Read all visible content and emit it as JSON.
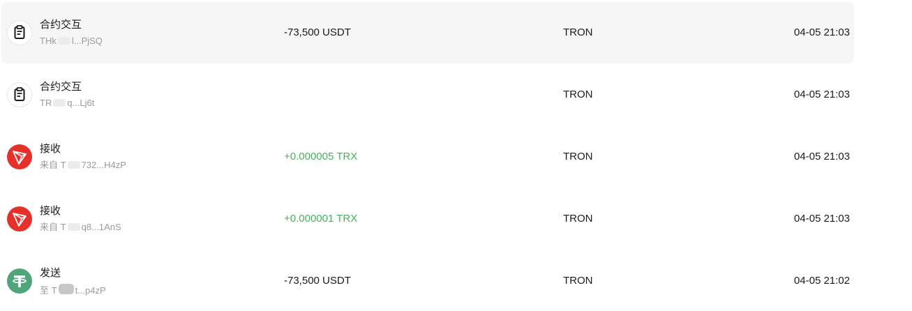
{
  "colors": {
    "positive": "#47b05f",
    "tron_red": "#e5312a",
    "tether_green": "#50a57b",
    "highlight_bg": "#f6f6f6"
  },
  "transactions": [
    {
      "icon": "contract-clipboard-icon",
      "title": "合约交互",
      "sub_prefix": "THk",
      "sub_mid": "l...PjSQ",
      "amount": "-73,500 USDT",
      "network": "TRON",
      "time": "04-05 21:03"
    },
    {
      "icon": "contract-clipboard-icon",
      "title": "合约交互",
      "sub_prefix": "TR",
      "sub_mid": "q...Lj6t",
      "amount": "",
      "network": "TRON",
      "time": "04-05 21:03"
    },
    {
      "icon": "tron-logo-icon",
      "title": "接收",
      "sub_prefix": "来自 T",
      "sub_mid": "732...H4zP",
      "amount": "+0.000005 TRX",
      "network": "TRON",
      "time": "04-05 21:03"
    },
    {
      "icon": "tron-logo-icon",
      "title": "接收",
      "sub_prefix": "来自 T",
      "sub_mid": "q8...1AnS",
      "amount": "+0.000001 TRX",
      "network": "TRON",
      "time": "04-05 21:03"
    },
    {
      "icon": "tether-logo-icon",
      "title": "发送",
      "sub_prefix": "至 T",
      "sub_mid": "t...p4zP",
      "amount": "-73,500 USDT",
      "network": "TRON",
      "time": "04-05 21:02"
    }
  ]
}
